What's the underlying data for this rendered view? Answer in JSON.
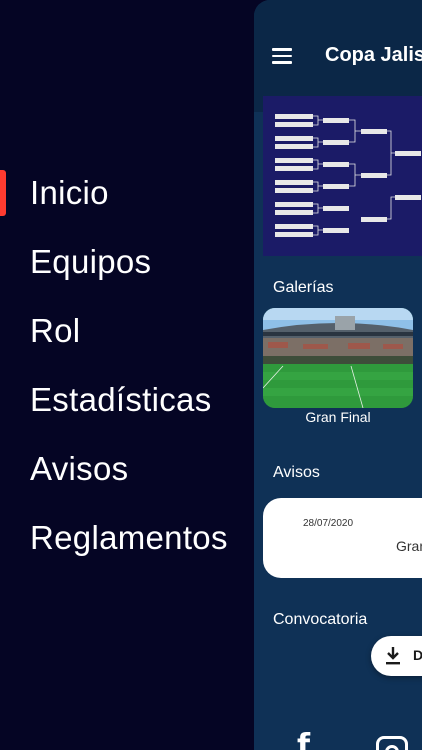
{
  "drawer": {
    "items": [
      {
        "label": "Inicio",
        "active": true
      },
      {
        "label": "Equipos"
      },
      {
        "label": "Rol"
      },
      {
        "label": "Estadísticas"
      },
      {
        "label": "Avisos"
      },
      {
        "label": "Reglamentos"
      }
    ],
    "active_color": "#ff3b30"
  },
  "app": {
    "title": "Copa Jalisc",
    "sections": {
      "galleries": "Galerías",
      "notices": "Avisos",
      "call": "Convocatoria"
    },
    "gallery": [
      {
        "caption": "Gran Final"
      }
    ],
    "notices": [
      {
        "date": "28/07/2020",
        "text": "Gran"
      }
    ],
    "download_button": {
      "label": "D",
      "icon": "download-icon"
    },
    "social": [
      {
        "icon": "facebook-icon"
      },
      {
        "icon": "instagram-icon"
      }
    ]
  },
  "colors": {
    "drawer_bg": "#050524",
    "app_bg": "#0f3156",
    "appbar_bg": "#0b2747"
  }
}
